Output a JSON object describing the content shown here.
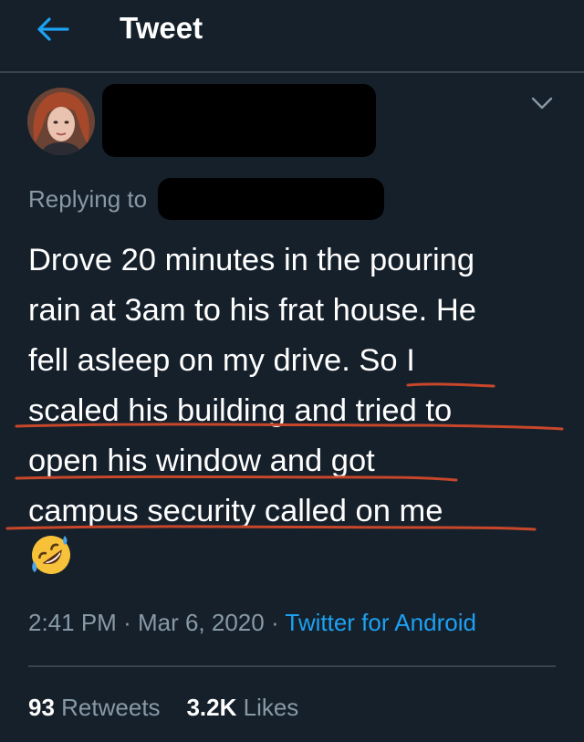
{
  "header": {
    "title": "Tweet",
    "back_icon": "arrow-left-icon",
    "accent_color": "#1da1f2"
  },
  "author": {
    "avatar_icon": "profile-photo",
    "name_redacted": true,
    "handle_redacted": true
  },
  "menu": {
    "icon": "chevron-down-icon"
  },
  "reply_context": {
    "label": "Replying to"
  },
  "tweet": {
    "lines": [
      "Drove 20 minutes in the pouring",
      "rain at 3am to his frat house. He",
      "fell asleep on my drive. So I",
      "scaled his building and tried to",
      "open his window and got",
      "campus security called on me"
    ],
    "emoji": "rolling-on-the-floor-laughing-emoji",
    "underline_color": "#c8472b"
  },
  "meta": {
    "time": "2:41 PM",
    "separator": "·",
    "date": "Mar 6, 2020",
    "source": "Twitter for Android"
  },
  "stats": {
    "retweets_count": "93",
    "retweets_label": "Retweets",
    "likes_count": "3.2K",
    "likes_label": "Likes"
  },
  "colors": {
    "background": "#15202b",
    "secondary_text": "#8899a6",
    "divider": "#38444d"
  }
}
